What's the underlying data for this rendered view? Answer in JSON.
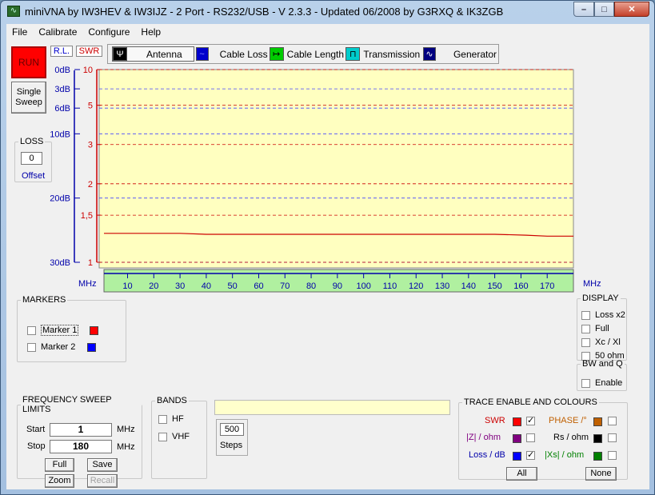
{
  "window": {
    "title": "miniVNA by IW3HEV & IW3IJZ - 2 Port - RS232/USB - V 2.3.3 - Updated 06/2008 by G3RXQ & IK3ZGB",
    "minimize": "–",
    "maximize": "□",
    "close": "✕"
  },
  "menu": [
    "File",
    "Calibrate",
    "Configure",
    "Help"
  ],
  "controls": {
    "run_label": "RUN",
    "single_sweep_line1": "Single",
    "single_sweep_line2": "Sweep",
    "rl_label": "R.L.",
    "swr_label": "SWR"
  },
  "loss": {
    "title": "LOSS",
    "value": "0",
    "offset_label": "Offset"
  },
  "tabs": [
    {
      "label": "Antenna",
      "icon": "antenna-icon"
    },
    {
      "label": "Cable Loss",
      "icon": "cable-loss-icon"
    },
    {
      "label": "Cable Length",
      "icon": "cable-length-icon"
    },
    {
      "label": "Transmission",
      "icon": "transmission-icon"
    },
    {
      "label": "Generator",
      "icon": "generator-icon"
    }
  ],
  "chart_data": {
    "type": "line",
    "xlabel": "MHz",
    "xlim": [
      1,
      180
    ],
    "x_ticks": [
      10,
      20,
      30,
      40,
      50,
      60,
      70,
      80,
      90,
      100,
      110,
      120,
      130,
      140,
      150,
      160,
      170
    ],
    "rl_ticks": [
      "0dB",
      "3dB",
      "6dB",
      "10dB",
      "20dB",
      "30dB"
    ],
    "rl_tick_values": [
      0,
      3,
      6,
      10,
      20,
      30
    ],
    "swr_ticks": [
      "10",
      "5",
      "3",
      "2",
      "1,5",
      "1"
    ],
    "swr_tick_values": [
      10,
      5,
      3,
      2,
      1.5,
      1
    ],
    "series": [
      {
        "name": "SWR",
        "color": "#cc0000",
        "x": [
          1,
          30,
          40,
          60,
          90,
          120,
          150,
          162,
          170,
          180
        ],
        "values": [
          1.28,
          1.28,
          1.27,
          1.27,
          1.27,
          1.27,
          1.27,
          1.26,
          1.25,
          1.25
        ]
      }
    ],
    "colors": {
      "plot_bg": "#ffffc0",
      "rl_grid": "#4444ff",
      "swr_grid": "#cc0000",
      "freq_bar": "#b0f0a0"
    }
  },
  "markers": {
    "title": "MARKERS",
    "items": [
      {
        "label": "Marker 1",
        "color": "#ff0000",
        "checked": false
      },
      {
        "label": "Marker 2",
        "color": "#0000ff",
        "checked": false
      }
    ]
  },
  "display": {
    "title": "DISPLAY",
    "options": [
      "Loss x2",
      "Full",
      "Xc / Xl",
      "50 ohm"
    ]
  },
  "bwq": {
    "title": "BW and Q",
    "enable": "Enable"
  },
  "freq_sweep": {
    "title": "FREQUENCY SWEEP LIMITS",
    "start_label": "Start",
    "start_value": "1",
    "start_unit": "MHz",
    "stop_label": "Stop",
    "stop_value": "180",
    "stop_unit": "MHz",
    "full": "Full",
    "save": "Save",
    "zoom": "Zoom",
    "recall": "Recall"
  },
  "bands": {
    "title": "BANDS",
    "hf": "HF",
    "vhf": "VHF"
  },
  "steps": {
    "value": "500",
    "label": "Steps"
  },
  "trace": {
    "title": "TRACE ENABLE AND COLOURS",
    "swr": {
      "label": "SWR",
      "color": "#ff0000",
      "text_color": "#cc0000"
    },
    "phase": {
      "label": "PHASE /°",
      "color": "#c06000",
      "text_color": "#c06000"
    },
    "z": {
      "label": "|Z| / ohm",
      "color": "#800080",
      "text_color": "#800080"
    },
    "rs": {
      "label": "Rs / ohm",
      "color": "#000000",
      "text_color": "#000000"
    },
    "loss": {
      "label": "Loss / dB",
      "color": "#0000ff",
      "text_color": "#0000aa"
    },
    "xs": {
      "label": "|Xs| / ohm",
      "color": "#008000",
      "text_color": "#008000"
    },
    "all": "All",
    "none": "None"
  }
}
